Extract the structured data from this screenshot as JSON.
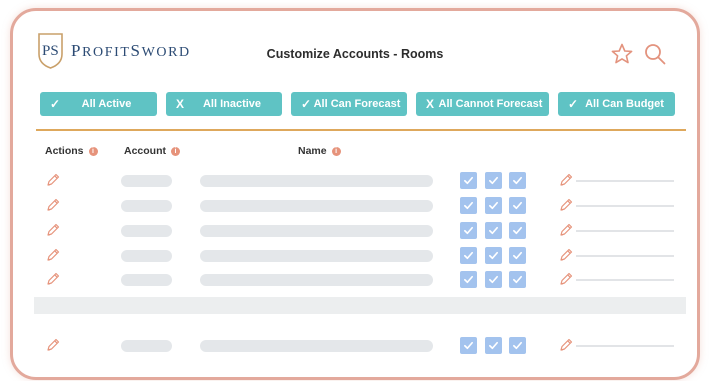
{
  "app": {
    "logo_initials": "PS",
    "logo_name_first": "P",
    "logo_name_rest": "ROFIT",
    "logo_name_first2": "S",
    "logo_name_rest2": "WORD",
    "title": "Customize Accounts - Rooms"
  },
  "icons": {
    "favorite": "star-icon",
    "search": "search-icon",
    "edit": "pencil-icon",
    "info": "info-icon",
    "check": "checkmark-icon",
    "close": "x-icon"
  },
  "colors": {
    "accent_teal": "#5fc3c4",
    "divider_gold": "#dea85c",
    "checkbox_blue": "#a3c3ee",
    "pencil_salmon": "#e6937b",
    "frame_border": "#e3a99c"
  },
  "filters": [
    {
      "glyph": "✓",
      "label": "All Active"
    },
    {
      "glyph": "X",
      "label": "All Inactive"
    },
    {
      "glyph": "✓",
      "label": "All Can Forecast"
    },
    {
      "glyph": "X",
      "label": "All Cannot Forecast"
    },
    {
      "glyph": "✓",
      "label": "All Can Budget"
    }
  ],
  "columns": {
    "actions": "Actions",
    "account": "Account",
    "name": "Name"
  },
  "rows": [
    {
      "checks": [
        true,
        true,
        true
      ]
    },
    {
      "checks": [
        true,
        true,
        true
      ]
    },
    {
      "checks": [
        true,
        true,
        true
      ]
    },
    {
      "checks": [
        true,
        true,
        true
      ]
    },
    {
      "checks": [
        true,
        true,
        true
      ]
    },
    {
      "checks": [
        true,
        true,
        true
      ]
    }
  ]
}
